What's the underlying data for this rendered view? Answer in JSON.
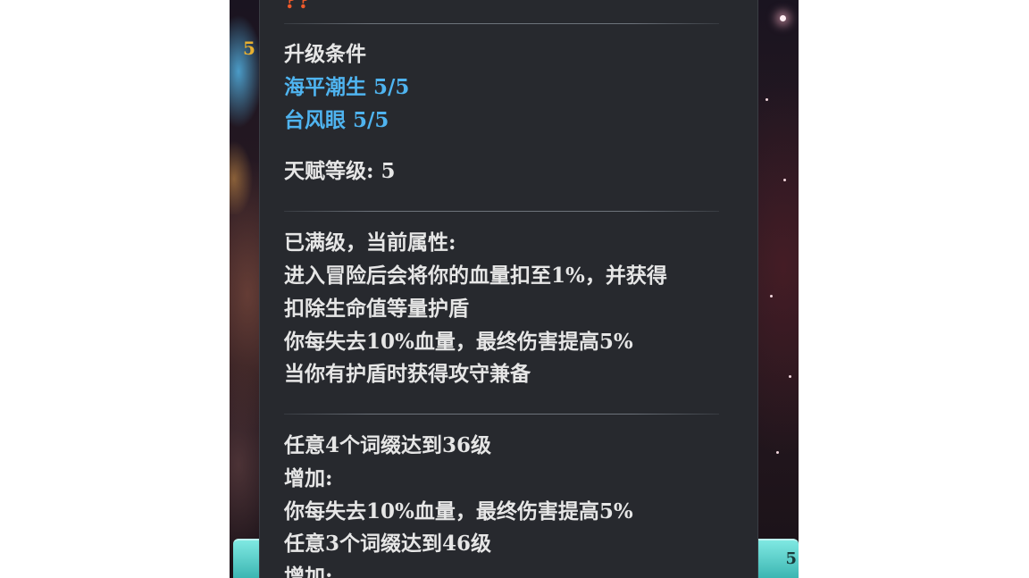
{
  "background": {
    "left_level_number": "5",
    "bottom_right_button_number": "5"
  },
  "tooltip": {
    "title": "??",
    "upgrade_section": {
      "heading": "升级条件",
      "requirements": [
        {
          "text": "海平潮生  5/5"
        },
        {
          "text": "台风眼  5/5"
        }
      ],
      "talent_level": "天赋等级: 5"
    },
    "current_attributes": {
      "heading": "已满级，当前属性:",
      "lines": [
        "进入冒险后会将你的血量扣至1%，并获得",
        "扣除生命值等量护盾",
        "你每失去10%血量，最终伤害提高5%",
        "当你有护盾时获得攻守兼备"
      ]
    },
    "bonus_section": {
      "lines": [
        "任意4个词缀达到36级",
        "增加:",
        "你每失去10%血量，最终伤害提高5%",
        "任意3个词缀达到46级",
        "增加:"
      ]
    }
  },
  "colors": {
    "panel_bg": "#27292e",
    "text_white": "#e6e6e6",
    "text_cyan": "#4fb4f0",
    "title_orange": "#f05a2a"
  }
}
